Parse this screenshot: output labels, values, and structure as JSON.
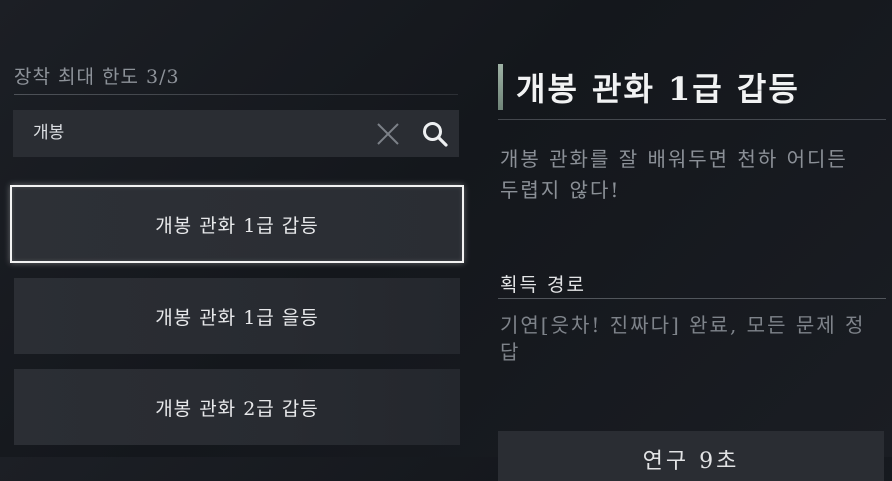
{
  "capacity": {
    "label": "장착 최대 한도 3/3"
  },
  "search": {
    "value": "개봉",
    "clear_icon": "close-icon",
    "search_icon": "search-icon"
  },
  "items": [
    {
      "label": "개봉 관화 1급 갑등",
      "selected": true
    },
    {
      "label": "개봉 관화 1급 을등",
      "selected": false
    },
    {
      "label": "개봉 관화 2급 갑등",
      "selected": false
    }
  ],
  "detail": {
    "title": "개봉 관화 1급 갑등",
    "description": "개봉 관화를 잘 배워두면 천하 어디든 두렵지 않다!",
    "acquisition_heading": "획득 경로",
    "acquisition_text": "기연[읏차! 진짜다] 완료, 모든 문제 정답",
    "action_label": "연구 9초"
  },
  "colors": {
    "accent": "#9fb3a6",
    "selected_border": "#f2f2f2",
    "panel_bg": "#2a2d33"
  }
}
